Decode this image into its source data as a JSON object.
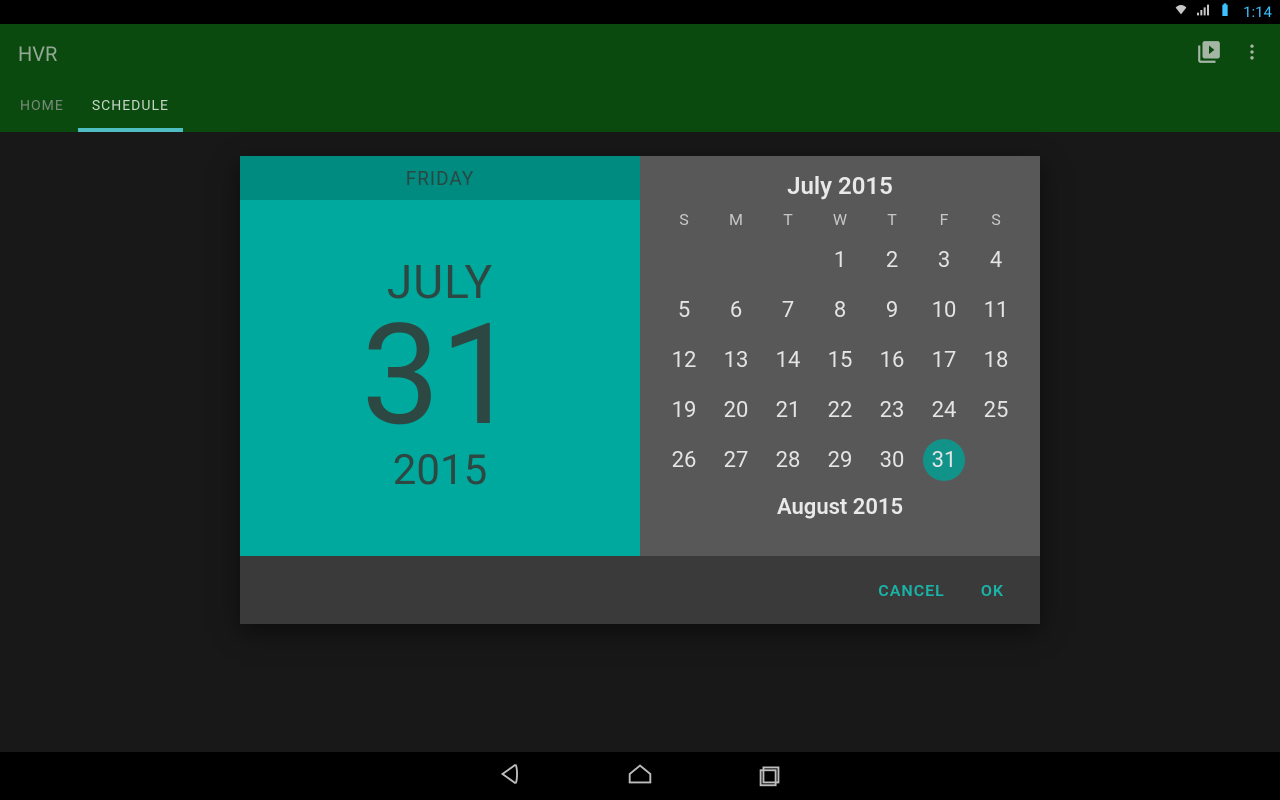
{
  "status": {
    "time": "1:14"
  },
  "appbar": {
    "title": "HVR",
    "tabs": [
      {
        "label": "HOME",
        "active": false
      },
      {
        "label": "SCHEDULE",
        "active": true
      }
    ]
  },
  "datepicker": {
    "selected": {
      "weekday": "FRIDAY",
      "month_label": "JULY",
      "day": "31",
      "year": "2015"
    },
    "month_title": "July 2015",
    "dow": [
      "S",
      "M",
      "T",
      "W",
      "T",
      "F",
      "S"
    ],
    "weeks": [
      [
        "",
        "",
        "",
        "1",
        "2",
        "3",
        "4"
      ],
      [
        "5",
        "6",
        "7",
        "8",
        "9",
        "10",
        "11"
      ],
      [
        "12",
        "13",
        "14",
        "15",
        "16",
        "17",
        "18"
      ],
      [
        "19",
        "20",
        "21",
        "22",
        "23",
        "24",
        "25"
      ],
      [
        "26",
        "27",
        "28",
        "29",
        "30",
        "31",
        ""
      ]
    ],
    "selected_day": "31",
    "next_month_title": "August 2015",
    "buttons": {
      "cancel": "CANCEL",
      "ok": "OK"
    }
  }
}
